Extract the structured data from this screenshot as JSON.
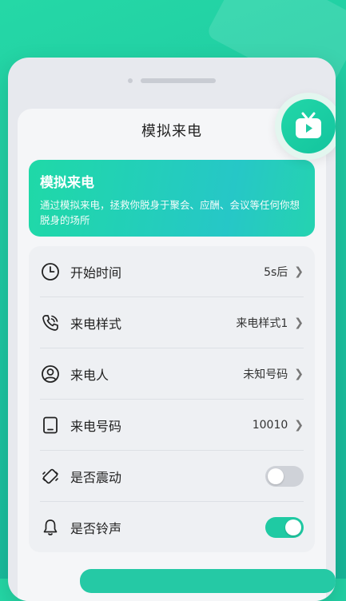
{
  "page": {
    "title": "模拟来电",
    "accent": "#1fcaa3"
  },
  "banner": {
    "title": "模拟来电",
    "description": "通过模拟来电，拯救你脱身于聚会、应酬、会议等任何你想脱身的场所"
  },
  "settings": [
    {
      "label": "开始时间",
      "value": "5s后",
      "icon": "clock-icon",
      "type": "select"
    },
    {
      "label": "来电样式",
      "value": "来电样式1",
      "icon": "phone-ring-icon",
      "type": "select"
    },
    {
      "label": "来电人",
      "value": "未知号码",
      "icon": "person-icon",
      "type": "select"
    },
    {
      "label": "来电号码",
      "value": "10010",
      "icon": "mobile-phone-icon",
      "type": "select"
    },
    {
      "label": "是否震动",
      "value": false,
      "icon": "vibrate-icon",
      "type": "toggle"
    },
    {
      "label": "是否铃声",
      "value": true,
      "icon": "bell-icon",
      "type": "toggle"
    }
  ]
}
